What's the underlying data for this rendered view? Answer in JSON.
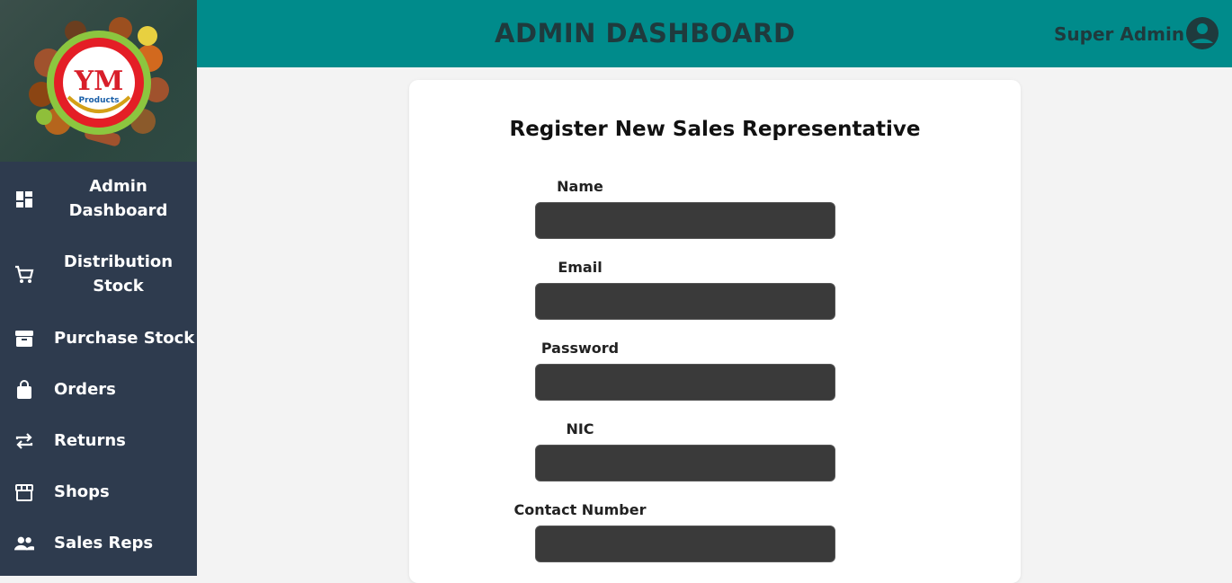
{
  "header": {
    "title": "ADMIN DASHBOARD",
    "user_name": "Super Admin"
  },
  "sidebar": {
    "logo_text": "YM",
    "logo_subtext": "Products",
    "items": [
      {
        "line1": "Admin",
        "line2": "Dashboard",
        "icon": "dashboard-icon"
      },
      {
        "line1": "Distribution",
        "line2": "Stock",
        "icon": "cart-icon"
      },
      {
        "label": "Purchase Stock",
        "icon": "archive-icon"
      },
      {
        "label": "Orders",
        "icon": "bag-icon"
      },
      {
        "label": "Returns",
        "icon": "repeat-icon"
      },
      {
        "label": "Shops",
        "icon": "store-icon"
      },
      {
        "label": "Sales Reps",
        "icon": "people-icon"
      }
    ]
  },
  "form": {
    "title": "Register New Sales Representative",
    "fields": [
      {
        "label": "Name",
        "value": ""
      },
      {
        "label": "Email",
        "value": ""
      },
      {
        "label": "Password",
        "value": ""
      },
      {
        "label": "NIC",
        "value": ""
      },
      {
        "label": "Contact Number",
        "value": ""
      }
    ]
  },
  "colors": {
    "header_bg": "#008b8b",
    "sidebar_bg": "#2e3b4e",
    "input_bg": "#3a3a3a",
    "page_bg": "#f3f3f3"
  }
}
